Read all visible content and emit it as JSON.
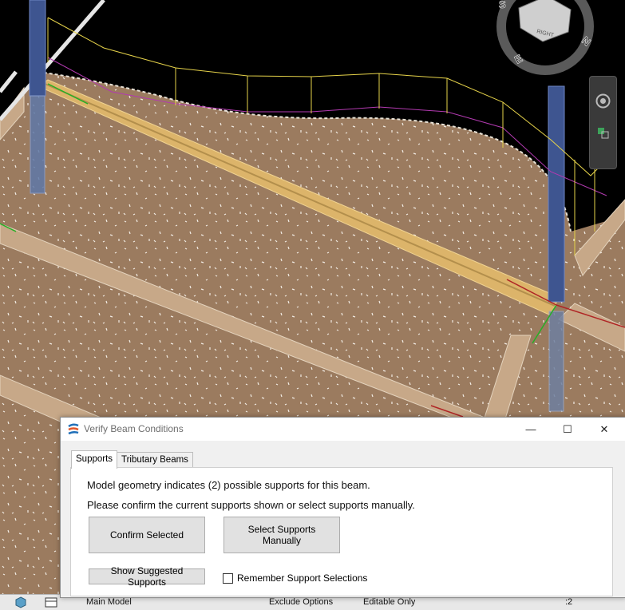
{
  "dialog": {
    "title": "Verify Beam Conditions",
    "tabs": [
      {
        "label": "Supports",
        "active": true
      },
      {
        "label": "Tributary Beams",
        "active": false
      }
    ],
    "message_line1": "Model geometry indicates (2) possible supports for this beam.",
    "message_line2": "Please confirm the current supports shown or select supports manually.",
    "confirm_button": "Confirm Selected",
    "manual_button": "Select Supports Manually",
    "suggested_button": "Show Suggested Supports",
    "remember_label": "Remember Support Selections",
    "remember_checked": false,
    "minimize_glyph": "—",
    "maximize_glyph": "☐",
    "close_glyph": "✕"
  },
  "viewcube": {
    "face_label": "RIGHT",
    "compass": [
      "S",
      "E",
      "N"
    ]
  },
  "statusbar": {
    "model": "Main Model",
    "exclude_options": "Exclude Options",
    "editable": "Editable Only",
    "counter": ":2"
  },
  "colors": {
    "floor": "#9b7b5f",
    "beam_highlight": "#dcb46a",
    "column": "#4a5f96",
    "load_yellow": "#e6d34a",
    "load_magenta": "#b23ab0",
    "background": "#000000"
  }
}
